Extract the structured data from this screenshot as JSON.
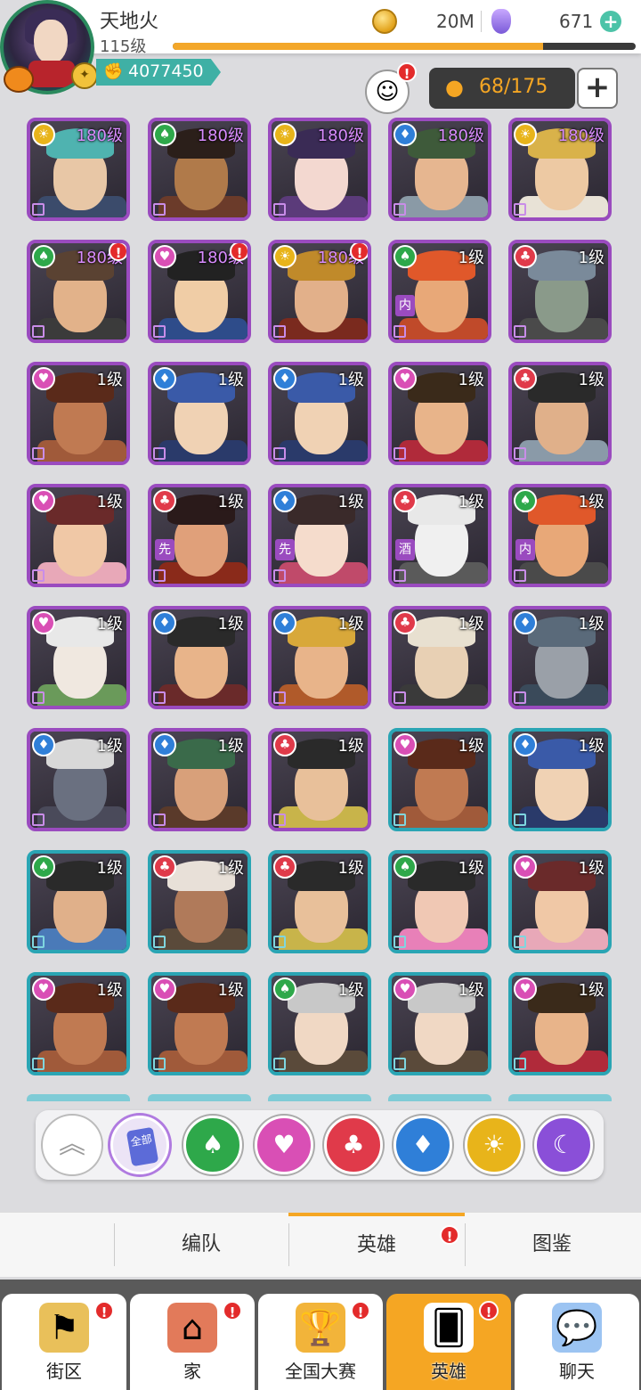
{
  "player": {
    "name": "天地火",
    "level": "115级",
    "power": "4077450",
    "exp_progress": 0.8
  },
  "resources": {
    "coins": "20M",
    "gems": "671"
  },
  "hero_capacity": "68/175",
  "colors": {
    "purple_frame": "#9a4bbf",
    "teal_frame": "#2aa5b4",
    "accent_orange": "#f5a623",
    "alert_red": "#e32b2b"
  },
  "heroes": [
    {
      "level": "180级",
      "suit": "sun",
      "frame": "purple",
      "skin": "#e8c7a6",
      "hat": "#4fb3b0",
      "body": "#3b4b6b"
    },
    {
      "level": "180级",
      "suit": "spade",
      "frame": "purple",
      "skin": "#b07a4a",
      "hat": "#2b1f1a",
      "body": "#6b3b2a"
    },
    {
      "level": "180级",
      "suit": "sun",
      "frame": "purple",
      "skin": "#f3d8d0",
      "hat": "#3a2b55",
      "body": "#5b3b7a"
    },
    {
      "level": "180级",
      "suit": "diamond",
      "frame": "purple",
      "skin": "#e6b690",
      "hat": "#3e5a3a",
      "body": "#8a9aa6"
    },
    {
      "level": "180级",
      "suit": "sun",
      "frame": "purple",
      "skin": "#edc9a3",
      "hat": "#d9b24a",
      "body": "#e8e2d6"
    },
    {
      "level": "180级",
      "suit": "spade",
      "frame": "purple",
      "skin": "#e2b28a",
      "hat": "#5a4232",
      "body": "#3b3b3b",
      "alert": true
    },
    {
      "level": "180级",
      "suit": "heart",
      "frame": "purple",
      "skin": "#f0cda6",
      "hat": "#222",
      "body": "#2e4c8a",
      "alert": true
    },
    {
      "level": "180级",
      "suit": "sun",
      "frame": "purple",
      "skin": "#e2b08a",
      "hat": "#c08a2a",
      "body": "#7a2a1e",
      "alert": true
    },
    {
      "level": "1级",
      "suit": "spade",
      "frame": "purple",
      "skin": "#e8a878",
      "hat": "#e0582a",
      "body": "#c04a2a",
      "tag": "内"
    },
    {
      "level": "1级",
      "suit": "club",
      "frame": "purple",
      "skin": "#8a9a8a",
      "hat": "#7a8a9a",
      "body": "#4a4a4a"
    },
    {
      "level": "1级",
      "suit": "heart",
      "frame": "purple",
      "skin": "#c07a52",
      "hat": "#5a2a1a",
      "body": "#a05a3a"
    },
    {
      "level": "1级",
      "suit": "diamond",
      "frame": "purple",
      "skin": "#f0d2b4",
      "hat": "#3a5aa8",
      "body": "#2a3a6a"
    },
    {
      "level": "1级",
      "suit": "diamond",
      "frame": "purple",
      "skin": "#f0d2b4",
      "hat": "#3a5aa8",
      "body": "#2a3a6a"
    },
    {
      "level": "1级",
      "suit": "heart",
      "frame": "purple",
      "skin": "#e8b48a",
      "hat": "#3a2a1a",
      "body": "#b02a3a"
    },
    {
      "level": "1级",
      "suit": "club",
      "frame": "purple",
      "skin": "#e0b08a",
      "hat": "#2a2a2a",
      "body": "#8a9aa8"
    },
    {
      "level": "1级",
      "suit": "heart",
      "frame": "purple",
      "skin": "#f0c8a6",
      "hat": "#6a2a2a",
      "body": "#e8a8b8"
    },
    {
      "level": "1级",
      "suit": "club",
      "frame": "purple",
      "skin": "#e0a07a",
      "hat": "#2a1a1a",
      "body": "#8a2a1a",
      "tag": "先"
    },
    {
      "level": "1级",
      "suit": "diamond",
      "frame": "purple",
      "skin": "#f5dccc",
      "hat": "#3a2a2a",
      "body": "#c04a6a",
      "tag": "先"
    },
    {
      "level": "1级",
      "suit": "club",
      "frame": "purple",
      "skin": "#f0f0f0",
      "hat": "#e8e8e8",
      "body": "#5a5a5a",
      "tag": "酒"
    },
    {
      "level": "1级",
      "suit": "spade",
      "frame": "purple",
      "skin": "#e8a878",
      "hat": "#e0582a",
      "body": "#4a4a4a",
      "tag": "内"
    },
    {
      "level": "1级",
      "suit": "heart",
      "frame": "purple",
      "skin": "#f0e8e0",
      "hat": "#e8e8e8",
      "body": "#6a9a5a"
    },
    {
      "level": "1级",
      "suit": "diamond",
      "frame": "purple",
      "skin": "#e8b48a",
      "hat": "#2a2a2a",
      "body": "#6a2a2a"
    },
    {
      "level": "1级",
      "suit": "diamond",
      "frame": "purple",
      "skin": "#e8b48a",
      "hat": "#d8a83a",
      "body": "#b05a2a"
    },
    {
      "level": "1级",
      "suit": "club",
      "frame": "purple",
      "skin": "#e8d0b4",
      "hat": "#e8e0d0",
      "body": "#3a3a3a"
    },
    {
      "level": "1级",
      "suit": "diamond",
      "frame": "purple",
      "skin": "#9aa0a8",
      "hat": "#5a6a7a",
      "body": "#3a4a5a"
    },
    {
      "level": "1级",
      "suit": "diamond",
      "frame": "purple",
      "skin": "#6a7080",
      "hat": "#d8d8d8",
      "body": "#4a4a5a"
    },
    {
      "level": "1级",
      "suit": "diamond",
      "frame": "purple",
      "skin": "#d8a07a",
      "hat": "#3a6a4a",
      "body": "#5a3a2a"
    },
    {
      "level": "1级",
      "suit": "club",
      "frame": "purple",
      "skin": "#e8c09a",
      "hat": "#2a2a2a",
      "body": "#c8b44a"
    },
    {
      "level": "1级",
      "suit": "heart",
      "frame": "teal",
      "skin": "#c07a52",
      "hat": "#5a2a1a",
      "body": "#a05a3a"
    },
    {
      "level": "1级",
      "suit": "diamond",
      "frame": "teal",
      "skin": "#f0d2b4",
      "hat": "#3a5aa8",
      "body": "#2a3a6a"
    },
    {
      "level": "1级",
      "suit": "spade",
      "frame": "teal",
      "skin": "#e0b08a",
      "hat": "#2a2a2a",
      "body": "#4a7ab8"
    },
    {
      "level": "1级",
      "suit": "club",
      "frame": "teal",
      "skin": "#b07a5a",
      "hat": "#e8e0d8",
      "body": "#5a4a3a"
    },
    {
      "level": "1级",
      "suit": "club",
      "frame": "teal",
      "skin": "#e8c09a",
      "hat": "#2a2a2a",
      "body": "#c8b44a"
    },
    {
      "level": "1级",
      "suit": "spade",
      "frame": "teal",
      "skin": "#f0c8b4",
      "hat": "#2a2a2a",
      "body": "#e880b8"
    },
    {
      "level": "1级",
      "suit": "heart",
      "frame": "teal",
      "skin": "#f0c8a6",
      "hat": "#6a2a2a",
      "body": "#e8a8b8"
    },
    {
      "level": "1级",
      "suit": "heart",
      "frame": "teal",
      "skin": "#c07a52",
      "hat": "#5a2a1a",
      "body": "#a05a3a"
    },
    {
      "level": "1级",
      "suit": "heart",
      "frame": "teal",
      "skin": "#c07a52",
      "hat": "#5a2a1a",
      "body": "#a05a3a"
    },
    {
      "level": "1级",
      "suit": "spade",
      "frame": "teal",
      "skin": "#f0d8c4",
      "hat": "#c8c8c8",
      "body": "#5a4a3a"
    },
    {
      "level": "1级",
      "suit": "heart",
      "frame": "teal",
      "skin": "#f0d8c4",
      "hat": "#c8c8c8",
      "body": "#5a4a3a"
    },
    {
      "level": "1级",
      "suit": "heart",
      "frame": "teal",
      "skin": "#e8b48a",
      "hat": "#3a2a1a",
      "body": "#b02a3a"
    }
  ],
  "filters": [
    {
      "name": "scroll-up",
      "icon": "chevrons-up-icon",
      "color": "#ffffff"
    },
    {
      "name": "all",
      "label": "全部",
      "icon": "cards-icon",
      "color": "#ece4f6"
    },
    {
      "name": "spade",
      "icon": "spade-icon",
      "color": "#2ea84a"
    },
    {
      "name": "heart",
      "icon": "heart-icon",
      "color": "#d94fb5"
    },
    {
      "name": "club",
      "icon": "club-icon",
      "color": "#e03a4a"
    },
    {
      "name": "diamond",
      "icon": "diamond-icon",
      "color": "#2f7fd8"
    },
    {
      "name": "sun",
      "icon": "sun-icon",
      "color": "#e8b41a"
    },
    {
      "name": "moon",
      "icon": "moon-icon",
      "color": "#8a4fd8"
    }
  ],
  "subtabs": {
    "formation": "编队",
    "heroes": "英雄",
    "codex": "图鉴"
  },
  "nav": [
    {
      "label": "街区",
      "icon": "signpost-icon",
      "alert": true
    },
    {
      "label": "家",
      "icon": "house-icon",
      "alert": true
    },
    {
      "label": "全国大赛",
      "icon": "trophy-icon",
      "alert": true
    },
    {
      "label": "英雄",
      "icon": "hero-cards-icon",
      "alert": true,
      "active": true
    },
    {
      "label": "聊天",
      "icon": "chat-bubbles-icon",
      "alert": false
    }
  ],
  "alert_mark": "!"
}
